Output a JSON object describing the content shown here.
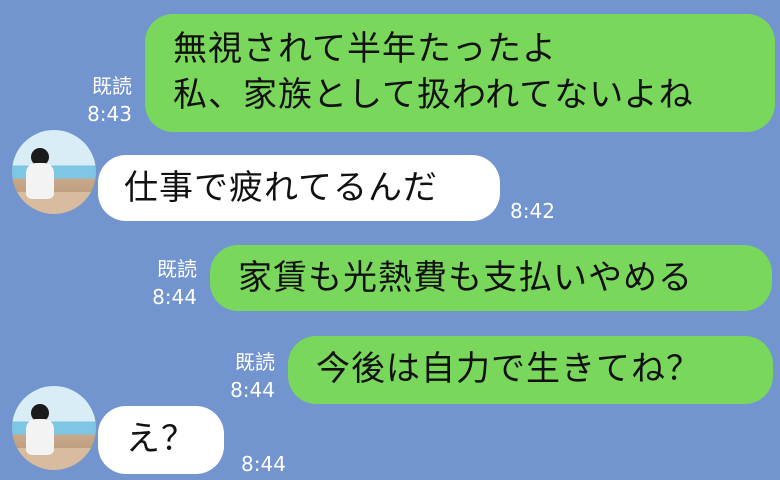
{
  "messages": [
    {
      "side": "out",
      "lines": [
        "無視されて半年たったよ",
        "私、家族として扱われてないよね"
      ],
      "read": "既読",
      "time": "8:43"
    },
    {
      "side": "in",
      "text": "仕事で疲れてるんだ",
      "time": "8:42"
    },
    {
      "side": "out",
      "text": "家賃も光熱費も支払いやめる",
      "read": "既読",
      "time": "8:44"
    },
    {
      "side": "out",
      "text": "今後は自力で生きてね？",
      "read": "既読",
      "time": "8:44"
    },
    {
      "side": "in",
      "text": "え？",
      "time": "8:44"
    }
  ]
}
